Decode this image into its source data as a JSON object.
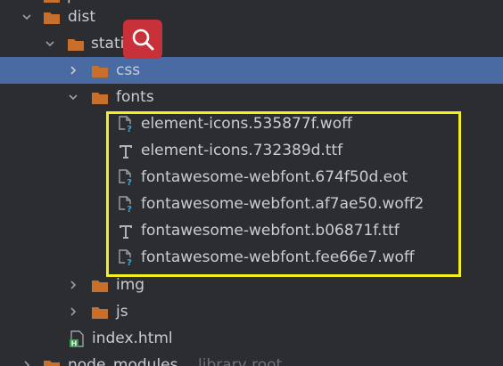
{
  "colors": {
    "background": "#2b2d30",
    "selection": "#4a6aa3",
    "folder": "#c86f2c",
    "text": "#c9cdd3",
    "highlight_border": "#f4ed1f",
    "search_badge": "#c8303a"
  },
  "tree": {
    "top_partial_label": "p",
    "dist_label": "dist",
    "static_label": "static",
    "css_label": "css",
    "fonts_label": "fonts",
    "font_files": [
      {
        "name": "element-icons.535877f.woff",
        "icon": "unknown-file-icon"
      },
      {
        "name": "element-icons.732389d.ttf",
        "icon": "font-file-icon"
      },
      {
        "name": "fontawesome-webfont.674f50d.eot",
        "icon": "unknown-file-icon"
      },
      {
        "name": "fontawesome-webfont.af7ae50.woff2",
        "icon": "unknown-file-icon"
      },
      {
        "name": "fontawesome-webfont.b06871f.ttf",
        "icon": "font-file-icon"
      },
      {
        "name": "fontawesome-webfont.fee66e7.woff",
        "icon": "unknown-file-icon"
      }
    ],
    "img_label": "img",
    "js_label": "js",
    "index_label": "index.html",
    "node_modules_label": "node_modules",
    "node_modules_note": "library root"
  }
}
